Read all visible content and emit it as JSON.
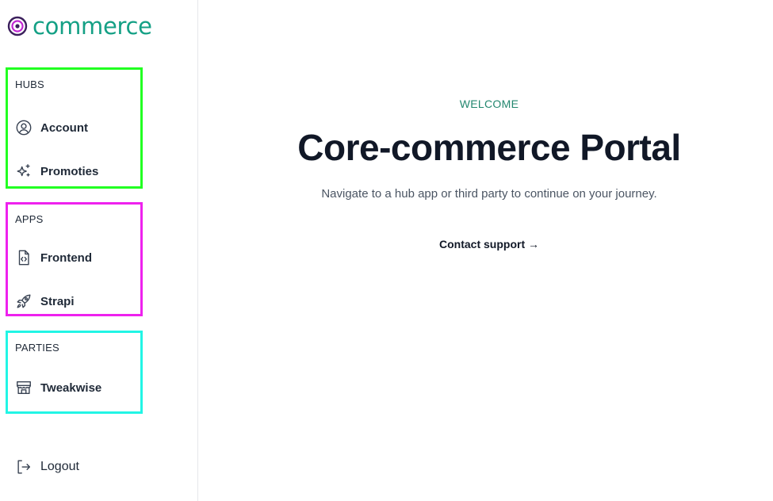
{
  "brand": {
    "name": "commerce",
    "color": "#14a085",
    "mark_icon": "concentric-circle-logo-icon"
  },
  "sidebar": {
    "groups": [
      {
        "title": "HUBS",
        "outline_color": "#22ff22",
        "items": [
          {
            "label": "Account",
            "icon": "user-circle-icon"
          },
          {
            "label": "Promoties",
            "icon": "sparkles-icon"
          }
        ]
      },
      {
        "title": "APPS",
        "outline_color": "#ee22ee",
        "items": [
          {
            "label": "Frontend",
            "icon": "code-file-icon"
          },
          {
            "label": "Strapi",
            "icon": "rocket-icon"
          }
        ]
      },
      {
        "title": "PARTIES",
        "outline_color": "#22f5e5",
        "items": [
          {
            "label": "Tweakwise",
            "icon": "storefront-icon"
          }
        ]
      }
    ],
    "logout": {
      "label": "Logout",
      "icon": "logout-arrow-icon"
    }
  },
  "main": {
    "eyebrow": "WELCOME",
    "eyebrow_color": "#23876f",
    "title": "Core-commerce Portal",
    "subtitle": "Navigate to a hub app or third party to continue on your journey.",
    "contact_link": "Contact support →"
  }
}
